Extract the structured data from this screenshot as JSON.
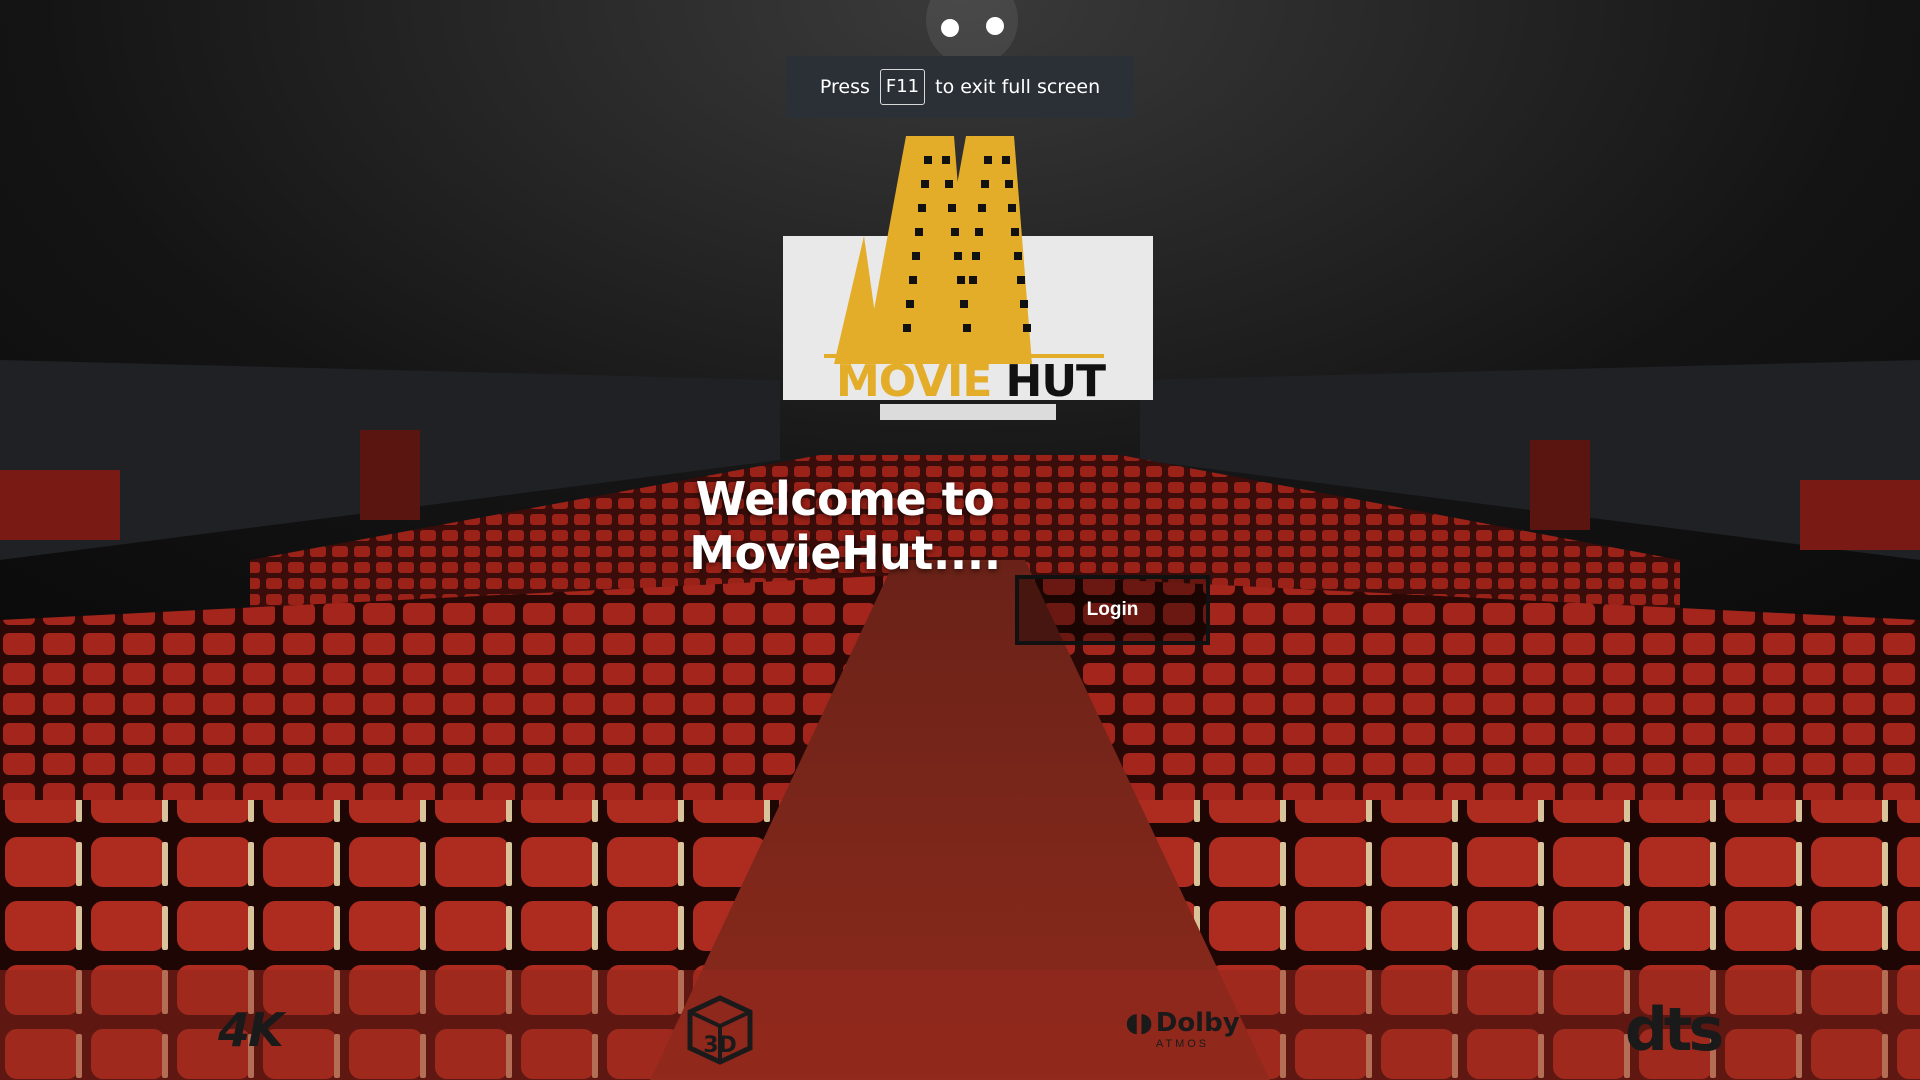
{
  "toast": {
    "press": "Press",
    "key": "F11",
    "suffix": "to exit full screen"
  },
  "logo": {
    "word1": "MOVIE",
    "word2": "HUT"
  },
  "hero": {
    "welcome": "Welcome to MovieHut....",
    "login_label": "Login"
  },
  "features": {
    "fourk": "4K",
    "threed": "3D",
    "dolby": "Dolby",
    "dolby_sub": "ATMOS",
    "dts": "dts"
  },
  "colors": {
    "brand_gold": "#e3ad2a",
    "seat_red": "#8a1c17",
    "toast_bg": "#2b2f36"
  }
}
